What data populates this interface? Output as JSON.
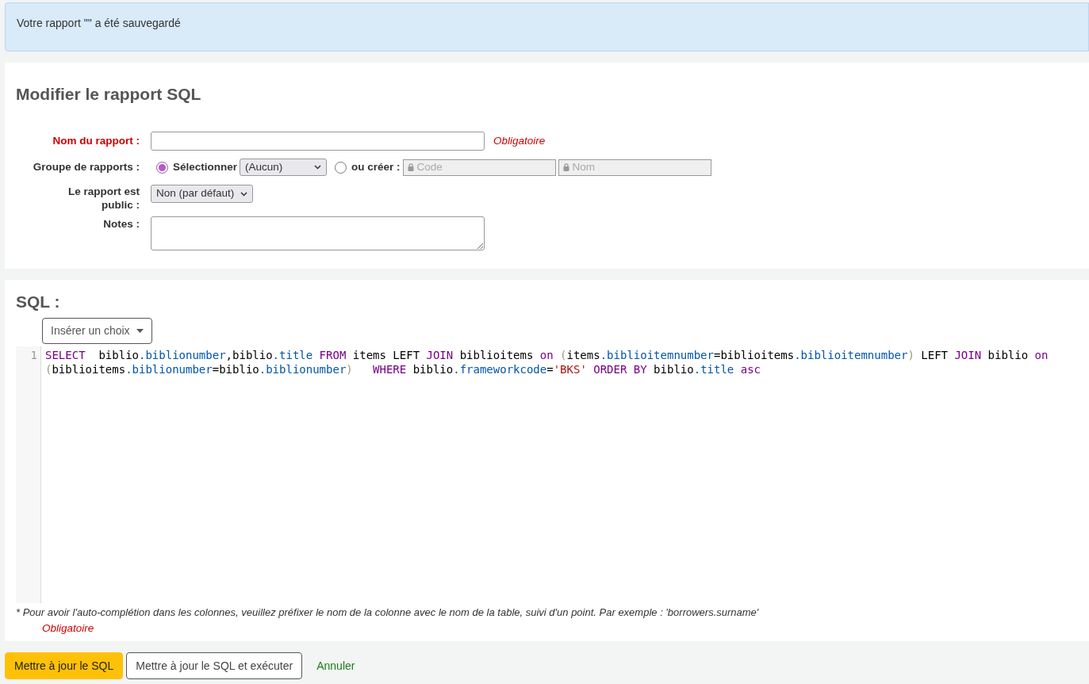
{
  "alert": {
    "text": "Votre rapport \"\" a été sauvegardé"
  },
  "form": {
    "title": "Modifier le rapport SQL",
    "name": {
      "label": "Nom du rapport :",
      "required_note": "Obligatoire"
    },
    "group": {
      "label": "Groupe de rapports :",
      "options": [
        {
          "kind": "select",
          "label": "Sélectionner",
          "selected": true,
          "value": "(Aucun)"
        },
        {
          "kind": "create",
          "label": "ou créer :",
          "selected": false,
          "placeholders": [
            "Code",
            "Nom"
          ]
        }
      ]
    },
    "public": {
      "label": "Le rapport est public :",
      "value": "Non (par défaut)"
    },
    "notes": {
      "label": "Notes :"
    }
  },
  "sql": {
    "title": "SQL :",
    "insert_button": "Insérer un choix",
    "lines": [
      {
        "number": "1",
        "tokens": [
          {
            "text": "SELECT",
            "kind": "keyword"
          },
          {
            "text": "  biblio",
            "kind": "plain"
          },
          {
            "text": ".biblionumber",
            "kind": "property"
          },
          {
            "text": ",biblio",
            "kind": "plain"
          },
          {
            "text": ".title",
            "kind": "property"
          },
          {
            "text": " FROM",
            "kind": "keyword"
          },
          {
            "text": " items LEFT ",
            "kind": "plain"
          },
          {
            "text": "JOIN",
            "kind": "keyword"
          },
          {
            "text": " biblioitems ",
            "kind": "plain"
          },
          {
            "text": "on",
            "kind": "keyword"
          },
          {
            "text": " (",
            "kind": "bracket"
          },
          {
            "text": "items",
            "kind": "plain"
          },
          {
            "text": ".biblioitemnumber",
            "kind": "property"
          },
          {
            "text": "=biblioitems",
            "kind": "plain"
          },
          {
            "text": ".biblioitemnumber",
            "kind": "property"
          },
          {
            "text": ")",
            "kind": "bracket"
          },
          {
            "text": " LEFT ",
            "kind": "plain"
          },
          {
            "text": "JOIN",
            "kind": "keyword"
          },
          {
            "text": " biblio ",
            "kind": "plain"
          },
          {
            "text": "on",
            "kind": "keyword"
          },
          {
            "text": " (",
            "kind": "bracket"
          },
          {
            "text": "biblioitems",
            "kind": "plain"
          },
          {
            "text": ".biblionumber",
            "kind": "property"
          },
          {
            "text": "=biblio",
            "kind": "plain"
          },
          {
            "text": ".biblionumber",
            "kind": "property"
          },
          {
            "text": ")",
            "kind": "bracket"
          },
          {
            "text": "   WHERE",
            "kind": "keyword"
          },
          {
            "text": " biblio",
            "kind": "plain"
          },
          {
            "text": ".frameworkcode",
            "kind": "property"
          },
          {
            "text": "=",
            "kind": "plain"
          },
          {
            "text": "'BKS'",
            "kind": "string"
          },
          {
            "text": " ORDER BY",
            "kind": "keyword"
          },
          {
            "text": " biblio",
            "kind": "plain"
          },
          {
            "text": ".title",
            "kind": "property"
          },
          {
            "text": " asc",
            "kind": "keyword"
          }
        ]
      }
    ],
    "hint": "* Pour avoir l'auto-complétion dans les colonnes, veuillez préfixer le nom de la colonne avec le nom de la table, suivi d'un point. Par exemple : 'borrowers.surname'",
    "required_note": "Obligatoire"
  },
  "actions": [
    {
      "kind": "primary",
      "label": "Mettre à jour le SQL"
    },
    {
      "kind": "secondary",
      "label": "Mettre à jour le SQL et exécuter"
    },
    {
      "kind": "link",
      "label": "Annuler"
    }
  ]
}
